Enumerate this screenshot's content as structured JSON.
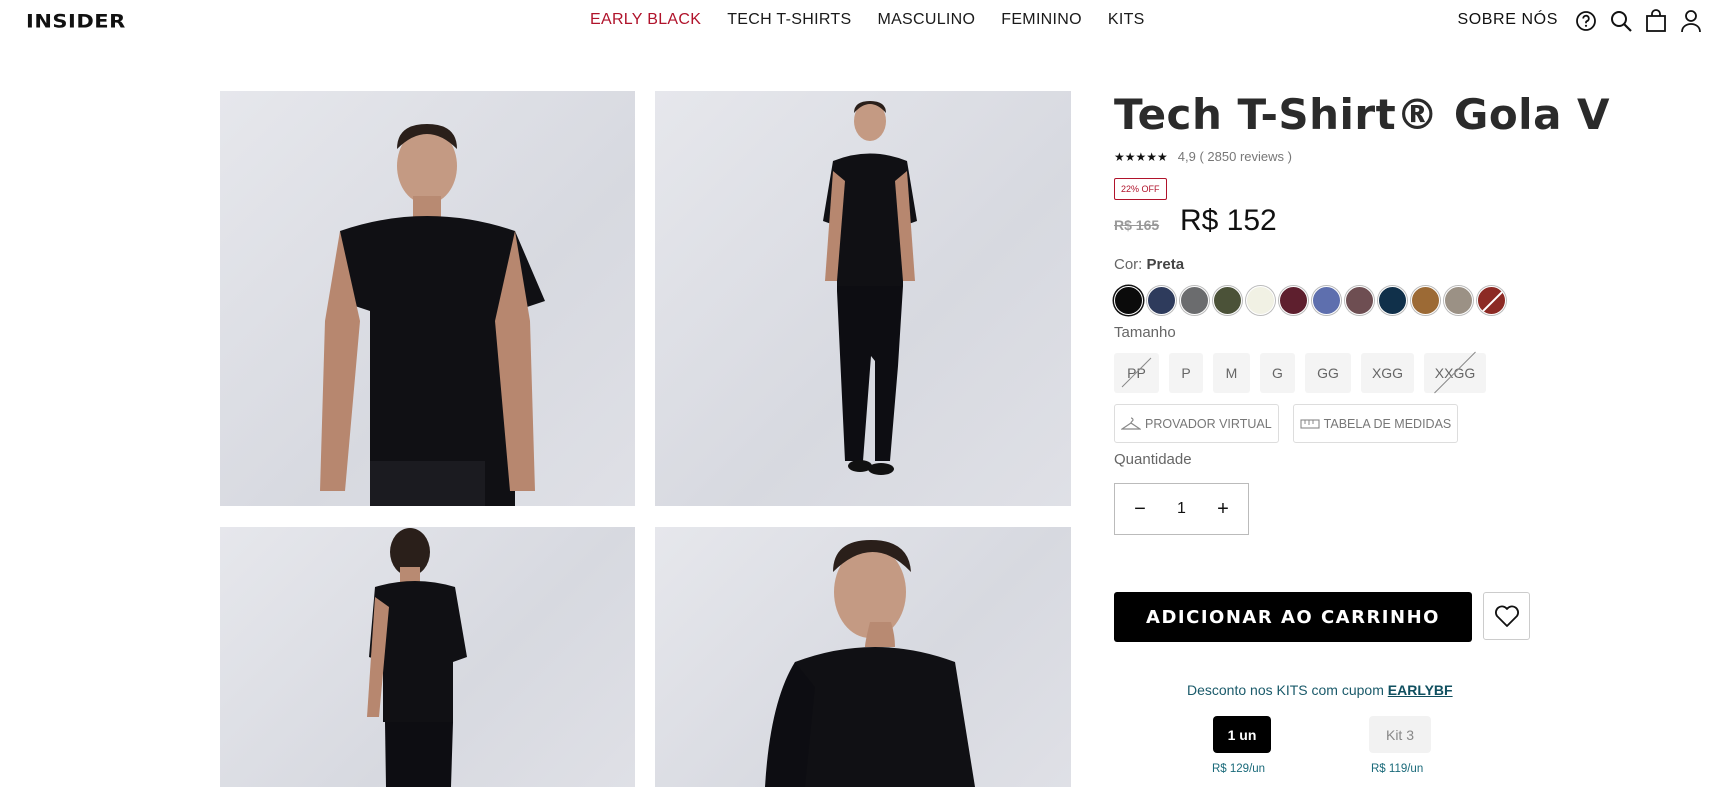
{
  "header": {
    "logo": "INSIDER",
    "nav": [
      "EARLY BLACK",
      "TECH T-SHIRTS",
      "MASCULINO",
      "FEMININO",
      "KITS"
    ],
    "about": "SOBRE NÓS",
    "icons": [
      "help-icon",
      "search-icon",
      "bag-icon",
      "user-icon"
    ],
    "accent_color": "#b0132b"
  },
  "gallery": {
    "images": [
      "product-front",
      "product-full-body",
      "product-back",
      "product-side"
    ]
  },
  "product": {
    "title": "Tech T-Shirt® Gola V",
    "stars": "★★★★★",
    "rating_text": "4,9 ( 2850 reviews )",
    "discount_badge": "22% OFF",
    "old_price": "R$ 165",
    "price": "R$ 152",
    "color_label": "Cor:",
    "color_value": "Preta",
    "swatches": [
      "#0b0b0b",
      "#2e3b5c",
      "#6b6c6e",
      "#4b5238",
      "#f1f1e4",
      "#5e1f2e",
      "#5e6fae",
      "#6e4e52",
      "#10304a",
      "#9c6a35",
      "#9b9185",
      "#8c2a24"
    ],
    "size_label": "Tamanho",
    "sizes": [
      {
        "label": "PP",
        "available": false
      },
      {
        "label": "P",
        "available": true
      },
      {
        "label": "M",
        "available": true
      },
      {
        "label": "G",
        "available": true
      },
      {
        "label": "GG",
        "available": true
      },
      {
        "label": "XGG",
        "available": true
      },
      {
        "label": "XXGG",
        "available": false
      }
    ],
    "virtual_fitting": "PROVADOR VIRTUAL",
    "size_chart": "TABELA DE MEDIDAS",
    "quantity_label": "Quantidade",
    "quantity": "1",
    "add_to_cart": "ADICIONAR AO CARRINHO",
    "promo_text": "Desconto nos KITS com cupom ",
    "promo_code": "EARLYBF",
    "kits": [
      {
        "label": "1 un",
        "price": "R$ 129/un"
      },
      {
        "label": "Kit 3",
        "price": "R$ 119/un"
      }
    ]
  }
}
